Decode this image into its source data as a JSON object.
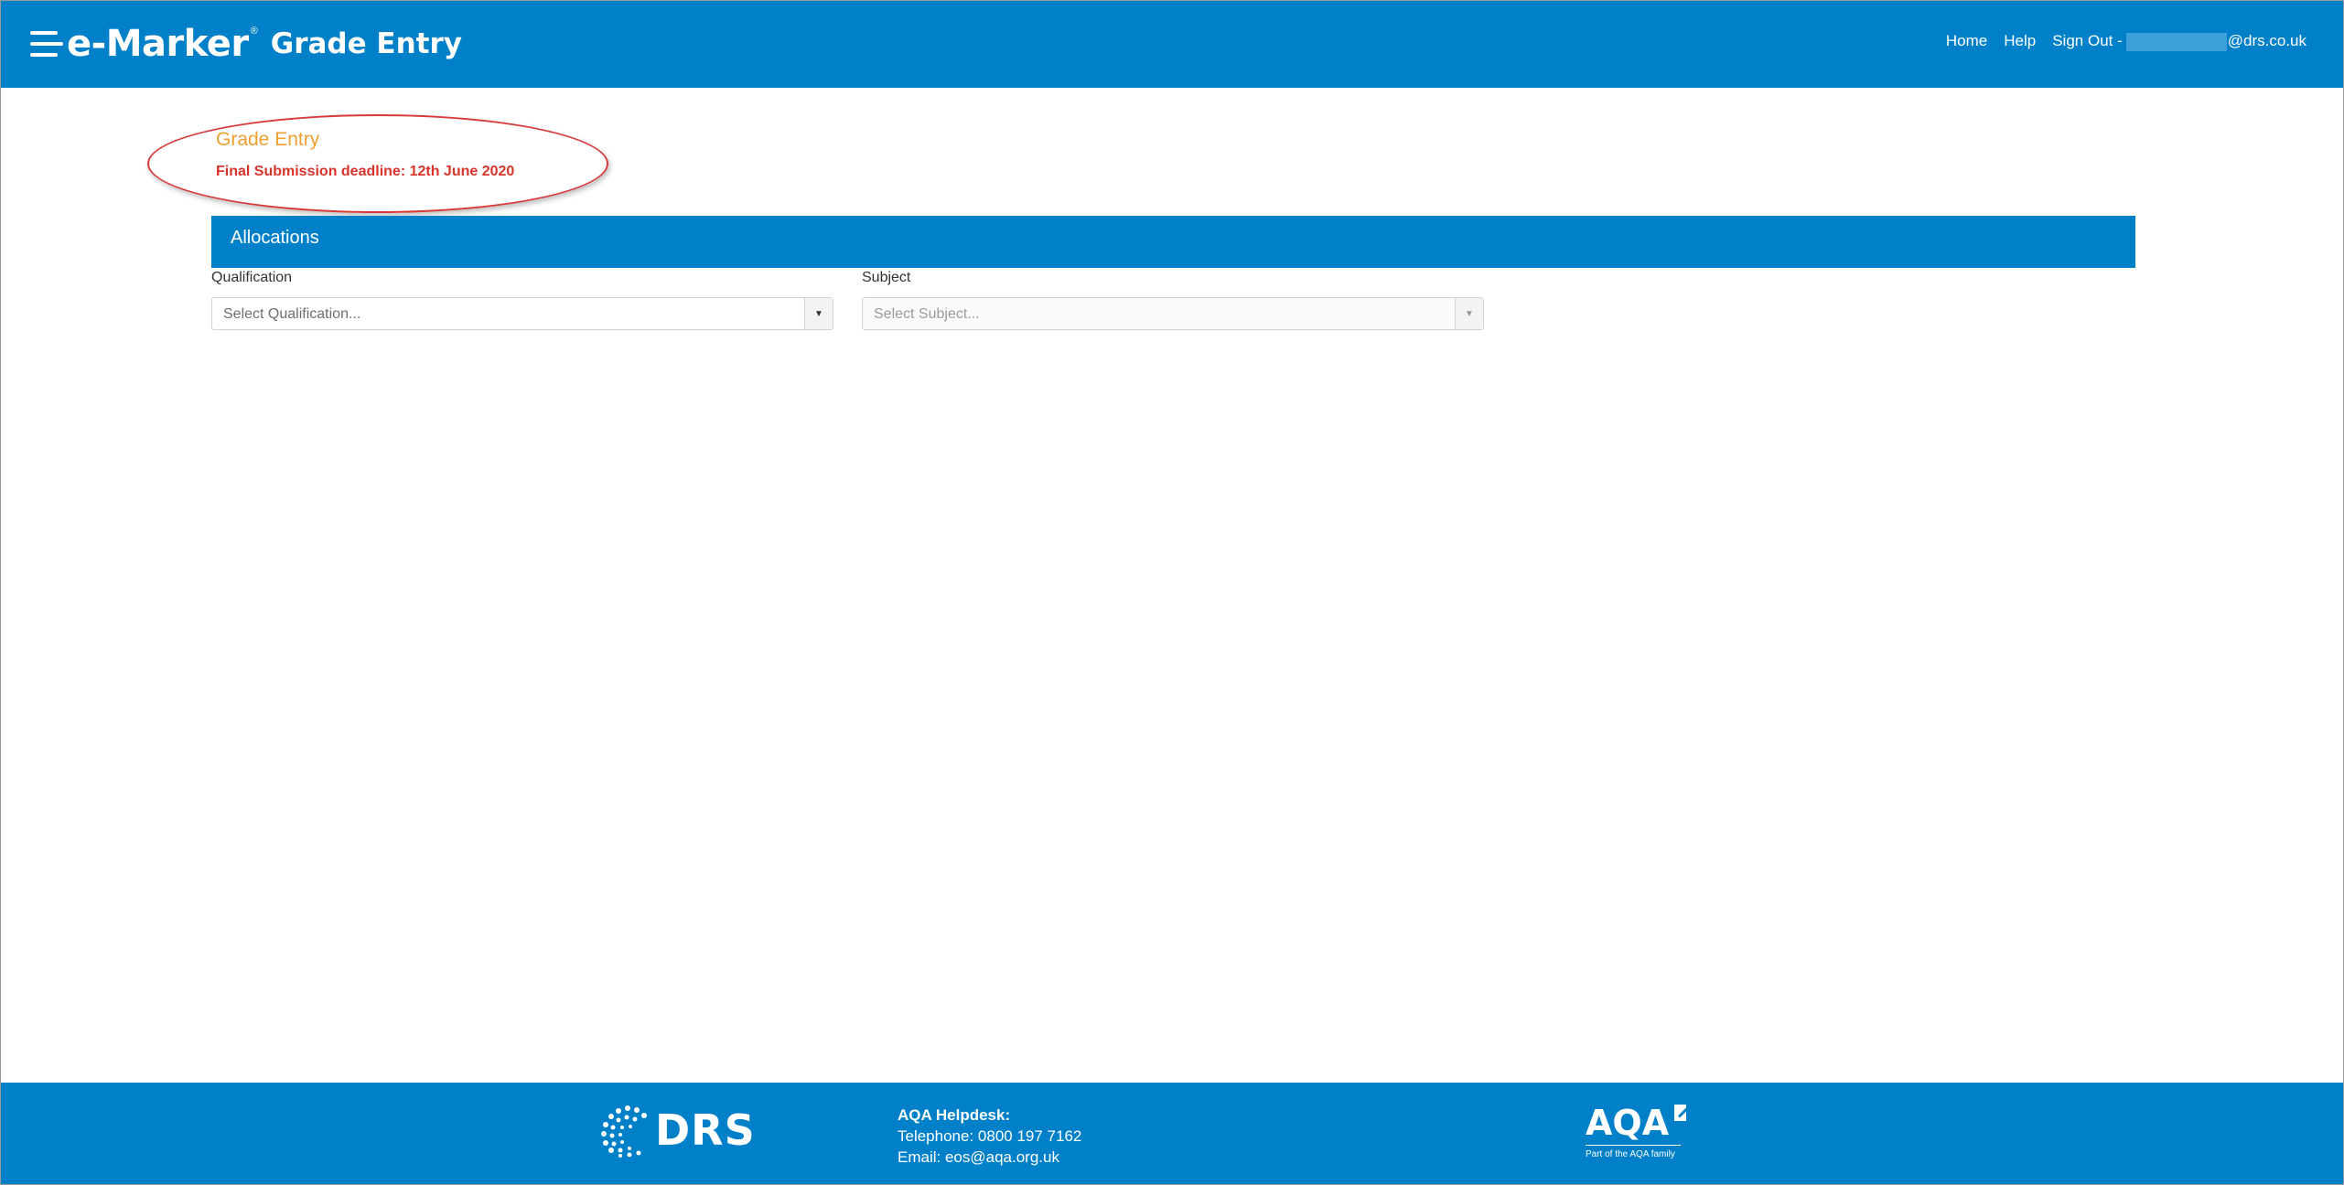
{
  "header": {
    "brand": "e-Marker",
    "brand_mark": "®",
    "app_title": "Grade Entry",
    "nav": {
      "home": "Home",
      "help": "Help",
      "sign_out": "Sign Out -",
      "email_domain": "@drs.co.uk"
    }
  },
  "page": {
    "title": "Grade Entry",
    "deadline": "Final Submission deadline: 12th June 2020"
  },
  "allocations": {
    "title": "Allocations",
    "qualification": {
      "label": "Qualification",
      "placeholder": "Select Qualification..."
    },
    "subject": {
      "label": "Subject",
      "placeholder": "Select Subject..."
    }
  },
  "footer": {
    "drs_logo": "DRS",
    "helpdesk_title": "AQA Helpdesk:",
    "telephone": "Telephone: 0800 197 7162",
    "email": "Email: eos@aqa.org.uk",
    "aqa_logo": "AQA",
    "aqa_tagline": "Part of the AQA family"
  },
  "colors": {
    "brand_blue": "#0080c9",
    "title_orange": "#f0a030",
    "deadline_red": "#d8342c",
    "annotation_red": "#d83a3a"
  }
}
